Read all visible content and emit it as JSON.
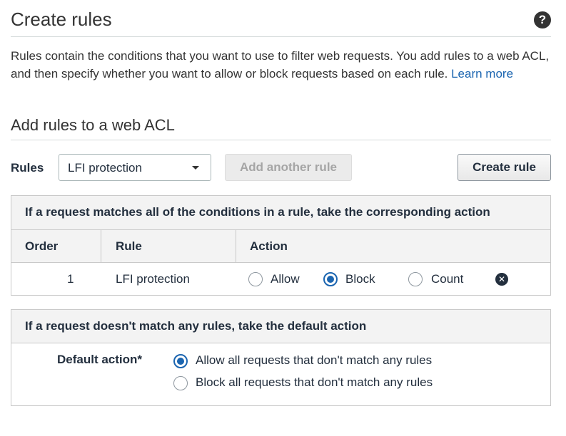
{
  "header": {
    "title": "Create rules",
    "help_icon": "question-circle-icon",
    "help_glyph": "?"
  },
  "intro": {
    "text": "Rules contain the conditions that you want to use to filter web requests. You add rules to a web ACL, and then specify whether you want to allow or block requests based on each rule. ",
    "link_text": "Learn more"
  },
  "add_rules": {
    "title": "Add rules to a web ACL",
    "rules_label": "Rules",
    "selected_rule": "LFI protection",
    "add_another_label": "Add another rule",
    "create_rule_label": "Create rule"
  },
  "rules_panel": {
    "header": "If a request matches all of the conditions in a rule, take the corresponding action",
    "columns": [
      "Order",
      "Rule",
      "Action"
    ],
    "rows": [
      {
        "order": "1",
        "rule": "LFI protection",
        "actions": [
          "Allow",
          "Block",
          "Count"
        ],
        "selected_action": "Block",
        "remove_icon": "remove-circle-icon",
        "remove_glyph": "✕"
      }
    ]
  },
  "default_panel": {
    "header": "If a request doesn't match any rules, take the default action",
    "label": "Default action*",
    "options": [
      "Allow all requests that don't match any rules",
      "Block all requests that don't match any rules"
    ],
    "selected_index": 0
  },
  "colors": {
    "accent": "#1b65b0",
    "text": "#232f3e",
    "panel_bg": "#f3f3f3",
    "border": "#c9c9c9"
  }
}
